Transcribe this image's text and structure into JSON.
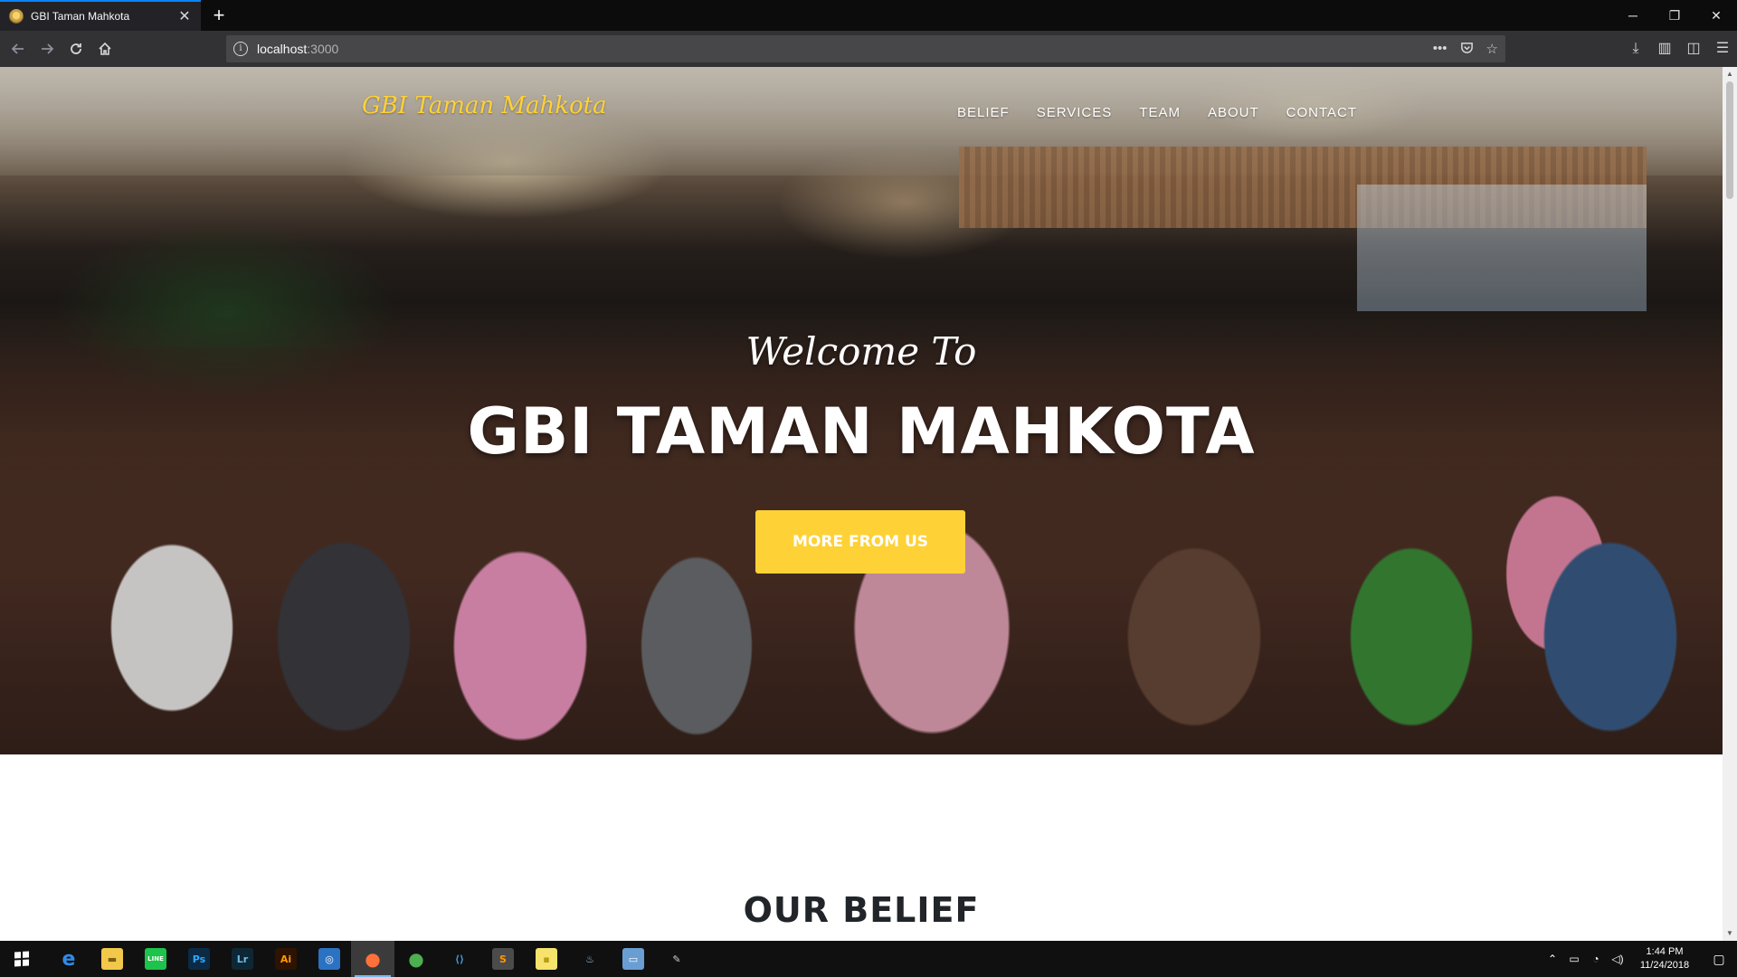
{
  "browser": {
    "tab_title": "GBI Taman Mahkota",
    "tab_close": "✕",
    "new_tab": "+",
    "url_host": "localhost",
    "url_port": ":3000",
    "window_controls": {
      "minimize": "─",
      "restore": "❐",
      "close": "✕"
    },
    "nav_icons": [
      "back-arrow-icon",
      "forward-arrow-icon",
      "reload-icon",
      "home-icon"
    ],
    "url_actions": [
      "page-actions-icon",
      "pocket-icon",
      "bookmark-star-icon"
    ],
    "toolbar_icons": [
      "download-icon",
      "library-icon",
      "sidebar-icon",
      "menu-icon"
    ]
  },
  "site": {
    "brand": "GBI Taman Mahkota",
    "menu": [
      "BELIEF",
      "SERVICES",
      "TEAM",
      "ABOUT",
      "CONTACT"
    ],
    "hero": {
      "subheading": "Welcome To",
      "heading": "GBI TAMAN MAHKOTA",
      "button": "MORE FROM US"
    },
    "section_heading": "OUR BELIEF",
    "accent_color": "#fed136"
  },
  "taskbar": {
    "apps": [
      {
        "name": "edge-icon",
        "label": "e",
        "bg": "transparent",
        "color": "#2f8be6"
      },
      {
        "name": "file-explorer-icon",
        "label": "▬",
        "bg": "#f2c84b",
        "color": "#7a5d12"
      },
      {
        "name": "line-icon",
        "label": "LINE",
        "bg": "#1dc34a",
        "color": "#ffffff"
      },
      {
        "name": "photoshop-icon",
        "label": "Ps",
        "bg": "#0b2a45",
        "color": "#31a8ff"
      },
      {
        "name": "lightroom-icon",
        "label": "Lr",
        "bg": "#0e2735",
        "color": "#6bbce8"
      },
      {
        "name": "illustrator-icon",
        "label": "Ai",
        "bg": "#2e1300",
        "color": "#ff9a00"
      },
      {
        "name": "instagram-icon",
        "label": "◎",
        "bg": "#2b72c2",
        "color": "#ffffff"
      },
      {
        "name": "firefox-icon",
        "label": "●",
        "bg": "transparent",
        "color": "#ff7139",
        "active": true
      },
      {
        "name": "chrome-icon",
        "label": "●",
        "bg": "transparent",
        "color": "#4caf50"
      },
      {
        "name": "vscode-icon",
        "label": "⟨⟩",
        "bg": "transparent",
        "color": "#3c9ee5"
      },
      {
        "name": "sublime-icon",
        "label": "S",
        "bg": "#4b4b4b",
        "color": "#ff9800"
      },
      {
        "name": "sticky-notes-icon",
        "label": "▪",
        "bg": "#f7e26b",
        "color": "#b79d12"
      },
      {
        "name": "steam-icon",
        "label": "♨",
        "bg": "transparent",
        "color": "#9ec9ef"
      },
      {
        "name": "remote-desktop-icon",
        "label": "▭",
        "bg": "#6a9ed3",
        "color": "#ffffff"
      },
      {
        "name": "paint-icon",
        "label": "✎",
        "bg": "transparent",
        "color": "#cfcfcf"
      }
    ],
    "tray_icons": [
      "chevron-up-icon",
      "battery-icon",
      "wifi-icon",
      "volume-icon"
    ],
    "time": "1:44 PM",
    "date": "11/24/2018"
  }
}
